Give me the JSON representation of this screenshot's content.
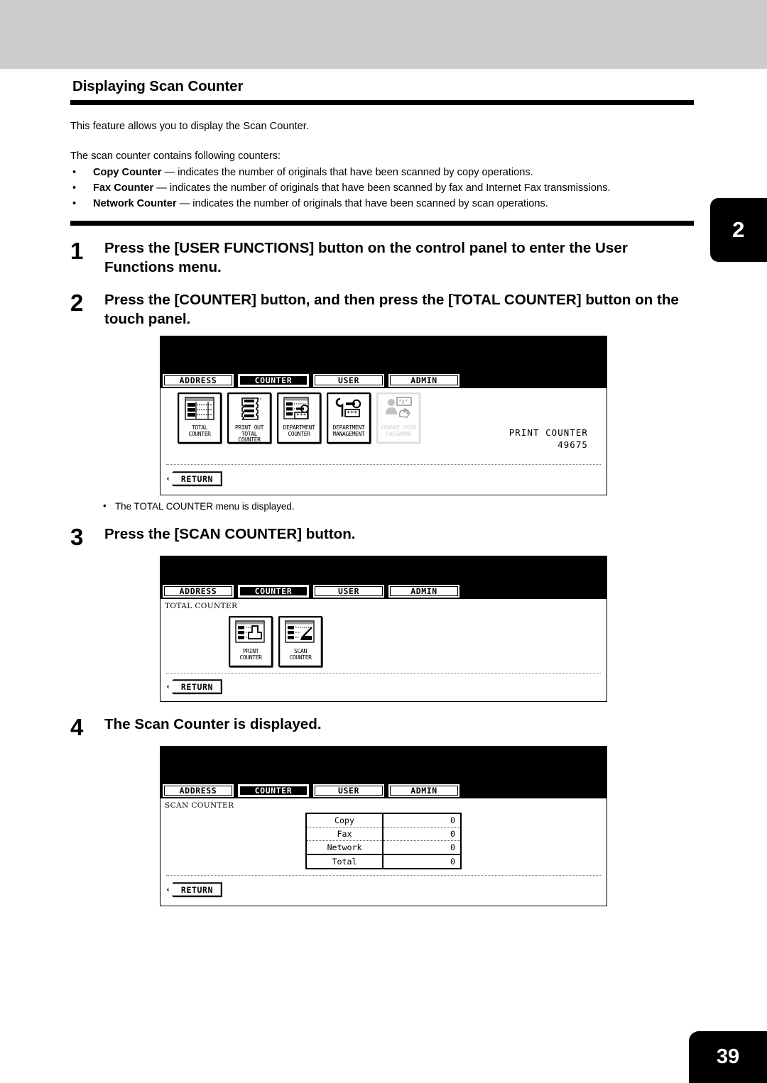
{
  "page": {
    "chapter_tab": "2",
    "page_number": "39"
  },
  "document": {
    "title": "Displaying Scan Counter",
    "intro": "This feature allows you to display the Scan Counter.",
    "lead_in": "The scan counter contains following counters:",
    "bullets": [
      {
        "term": "Copy Counter",
        "rest": " — indicates the number of originals that have been scanned by copy operations."
      },
      {
        "term": "Fax Counter",
        "rest": " — indicates the number of originals that have been scanned by fax and Internet Fax transmissions."
      },
      {
        "term": "Network Counter",
        "rest": " — indicates the number of originals that have been scanned by scan operations."
      }
    ]
  },
  "steps": [
    {
      "number": "1",
      "text": "Press the [USER FUNCTIONS] button on the control panel to enter the User Functions menu."
    },
    {
      "number": "2",
      "text": "Press the [COUNTER] button, and then press the [TOTAL COUNTER] button on the touch panel.",
      "note": "The TOTAL COUNTER menu is displayed."
    },
    {
      "number": "3",
      "text": "Press the [SCAN COUNTER] button."
    },
    {
      "number": "4",
      "text": "The Scan Counter is displayed."
    }
  ],
  "panel1": {
    "tabs": [
      {
        "label": "ADDRESS",
        "active": false
      },
      {
        "label": "COUNTER",
        "active": true
      },
      {
        "label": "USER",
        "active": false
      },
      {
        "label": "ADMIN",
        "active": false
      }
    ],
    "icons": [
      {
        "caption": "TOTAL\nCOUNTER",
        "icon": "total-counter-icon",
        "disabled": false
      },
      {
        "caption": "PRINT OUT\nTOTAL COUNTER",
        "icon": "print-out-total-counter-icon",
        "disabled": false
      },
      {
        "caption": "DEPARTMENT\nCOUNTER",
        "icon": "department-counter-icon",
        "disabled": false
      },
      {
        "caption": "DEPARTMENT\nMANAGEMENT",
        "icon": "department-management-icon",
        "disabled": false
      },
      {
        "caption": "CHANGE USER\nPASSWORD",
        "icon": "change-user-password-icon",
        "disabled": true
      }
    ],
    "print_counter_label": "PRINT COUNTER",
    "print_counter_value": "49675",
    "return_label": "RETURN"
  },
  "panel2": {
    "tabs": [
      {
        "label": "ADDRESS",
        "active": false
      },
      {
        "label": "COUNTER",
        "active": true
      },
      {
        "label": "USER",
        "active": false
      },
      {
        "label": "ADMIN",
        "active": false
      }
    ],
    "caption": "TOTAL COUNTER",
    "icons": [
      {
        "caption": "PRINT\nCOUNTER",
        "icon": "print-counter-icon",
        "disabled": false
      },
      {
        "caption": "SCAN\nCOUNTER",
        "icon": "scan-counter-icon",
        "disabled": false
      }
    ],
    "return_label": "RETURN"
  },
  "panel3": {
    "tabs": [
      {
        "label": "ADDRESS",
        "active": false
      },
      {
        "label": "COUNTER",
        "active": true
      },
      {
        "label": "USER",
        "active": false
      },
      {
        "label": "ADMIN",
        "active": false
      }
    ],
    "caption": "SCAN COUNTER",
    "table": [
      {
        "label": "Copy",
        "value": "0"
      },
      {
        "label": "Fax",
        "value": "0"
      },
      {
        "label": "Network",
        "value": "0"
      },
      {
        "label": "Total",
        "value": "0"
      }
    ],
    "return_label": "RETURN"
  },
  "colors": {
    "header_band": "#cccccc",
    "ink": "#000000",
    "paper": "#ffffff",
    "disabled": "#9a9a9a"
  }
}
